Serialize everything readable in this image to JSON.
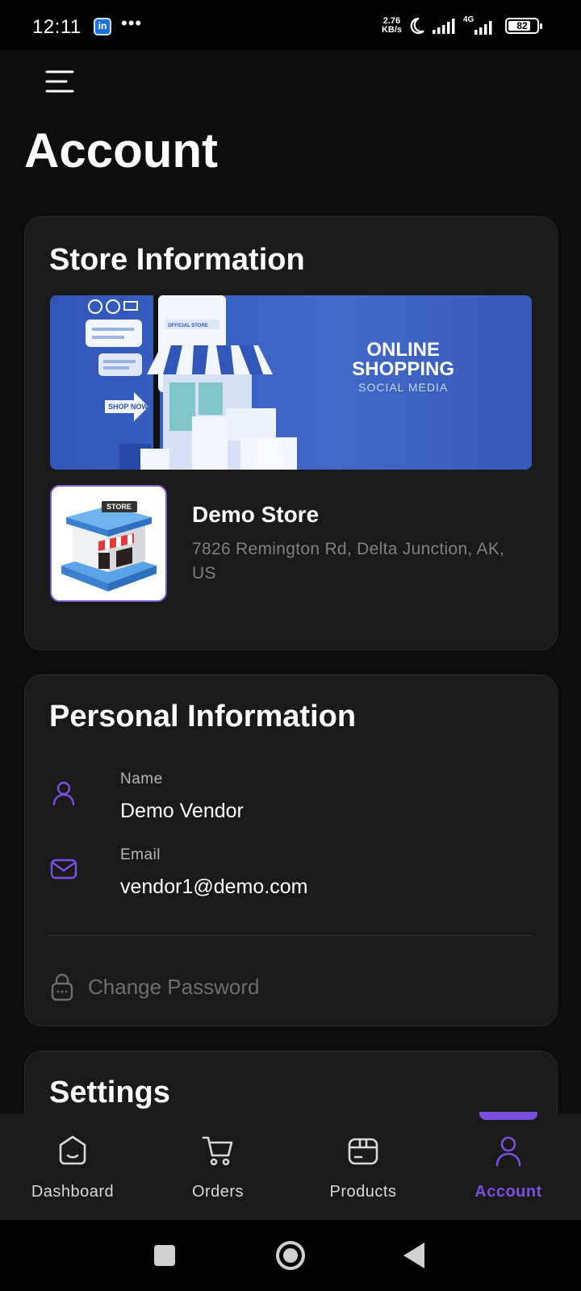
{
  "status_bar": {
    "time": "12:11",
    "app_badge": "in",
    "more": "•••",
    "net_speed_value": "2.76",
    "net_speed_unit": "KB/s",
    "network_label": "4G",
    "battery_percent": 82
  },
  "page": {
    "title": "Account"
  },
  "store_info": {
    "section_title": "Store Information",
    "banner": {
      "line1": "ONLINE",
      "line2": "SHOPPING",
      "line3": "SOCIAL MEDIA",
      "shop_now": "SHOP NOW",
      "official_store": "OFFICIAL STORE"
    },
    "logo_label": "STORE",
    "name": "Demo Store",
    "address": "7826 Remington Rd, Delta Junction, AK, US"
  },
  "personal_info": {
    "section_title": "Personal Information",
    "name_label": "Name",
    "name_value": "Demo Vendor",
    "email_label": "Email",
    "email_value": "vendor1@demo.com",
    "change_password_label": "Change Password"
  },
  "settings": {
    "section_title": "Settings"
  },
  "bottom_nav": {
    "items": [
      {
        "label": "Dashboard",
        "icon": "dashboard-icon"
      },
      {
        "label": "Orders",
        "icon": "cart-icon"
      },
      {
        "label": "Products",
        "icon": "box-icon"
      },
      {
        "label": "Account",
        "icon": "user-icon"
      }
    ],
    "active_index": 3
  },
  "colors": {
    "accent": "#7b4fe0",
    "background": "#0d0d0d",
    "card": "#1a1a1b",
    "banner_blue": "#3b63c4"
  }
}
